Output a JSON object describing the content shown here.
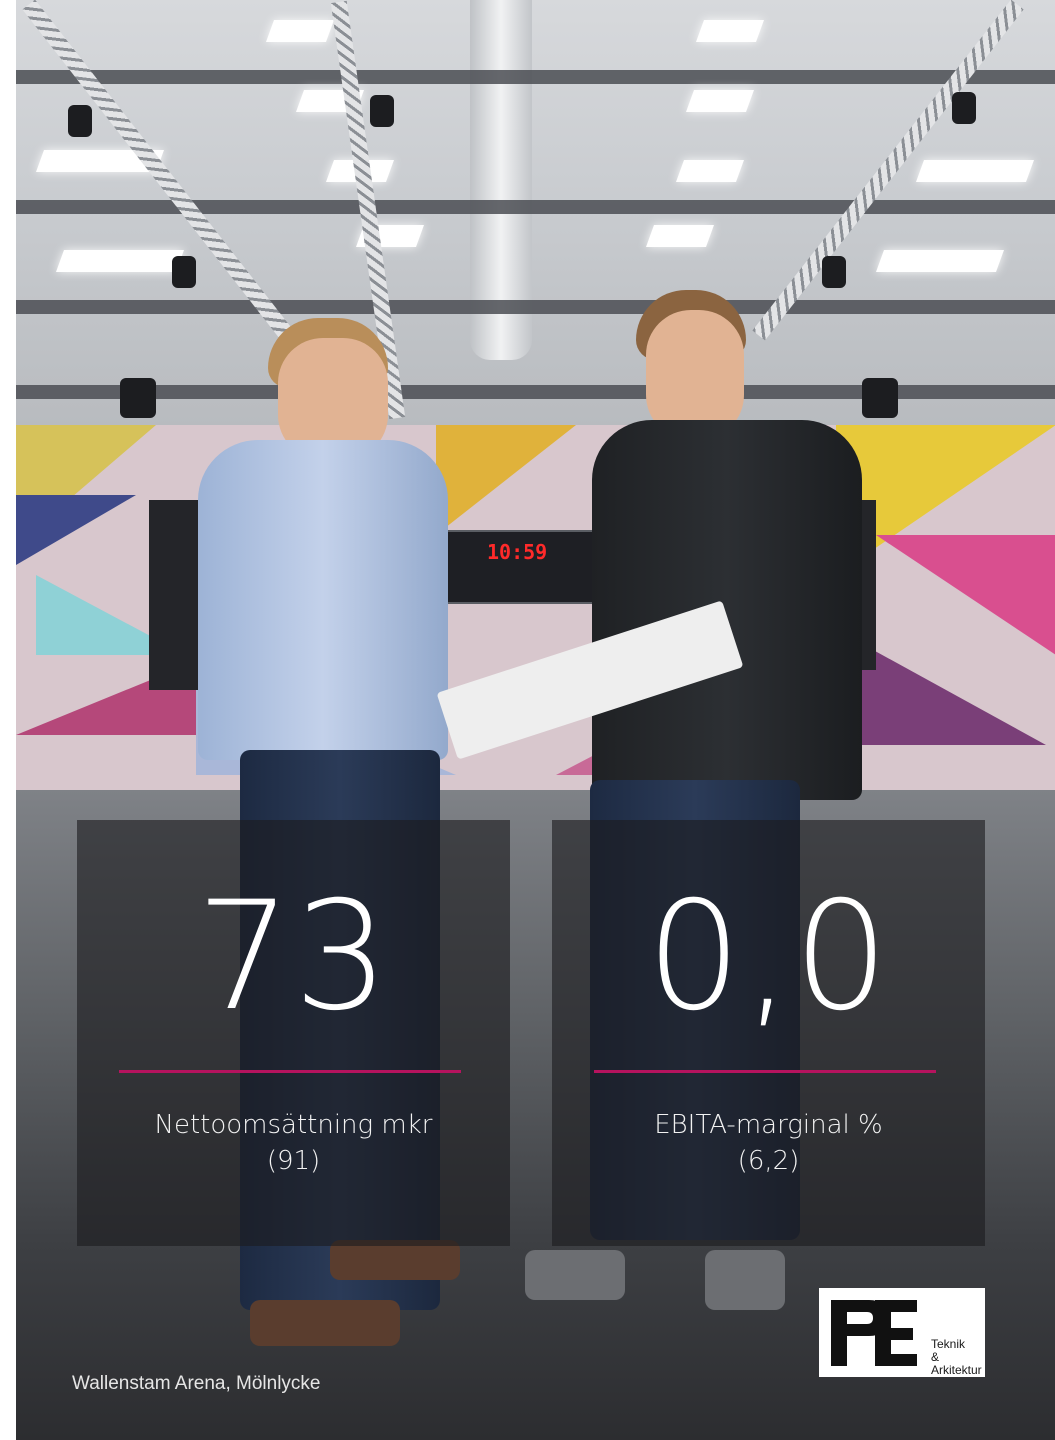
{
  "stats": [
    {
      "value": "73",
      "label": "Nettoomsättning mkr",
      "previous": "(91)"
    },
    {
      "value": "0,0",
      "label": "EBITA-marginal %",
      "previous": "(6,2)"
    }
  ],
  "caption": "Wallenstam Arena, Mölnlycke",
  "logo": {
    "line1": "Teknik",
    "line2": "& Arkitektur"
  },
  "scoreboard_time": "10:59",
  "colors": {
    "accent": "#b5135e",
    "panel_bg": "rgba(28,28,30,0.62)",
    "text": "#ffffff"
  }
}
